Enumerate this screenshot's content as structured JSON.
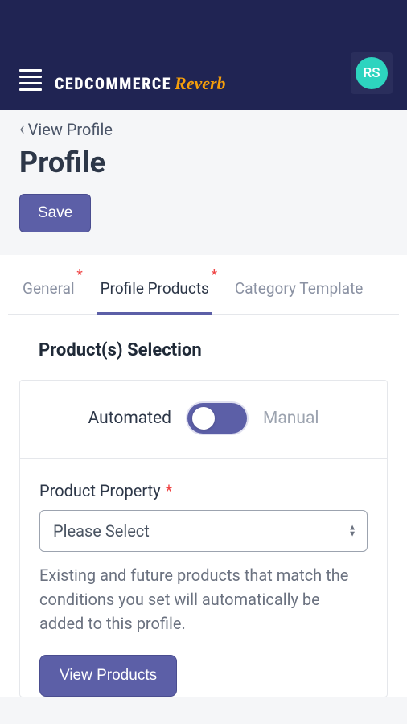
{
  "header": {
    "logo_primary": "CEDCOMMERCE",
    "logo_secondary": "Reverb",
    "avatar_initials": "RS"
  },
  "breadcrumb": {
    "label": "View Profile"
  },
  "page": {
    "title": "Profile",
    "save_button": "Save"
  },
  "tabs": [
    {
      "label": "General",
      "required": true,
      "active": false
    },
    {
      "label": "Profile Products",
      "required": true,
      "active": true
    },
    {
      "label": "Category Template",
      "required": false,
      "active": false
    }
  ],
  "section": {
    "title": "Product(s) Selection",
    "toggle_left": "Automated",
    "toggle_right": "Manual",
    "property_label": "Product Property",
    "select_placeholder": "Please Select",
    "help_text": "Existing and future products that match the conditions you set will automatically be added to this profile.",
    "view_button": "View Products"
  }
}
